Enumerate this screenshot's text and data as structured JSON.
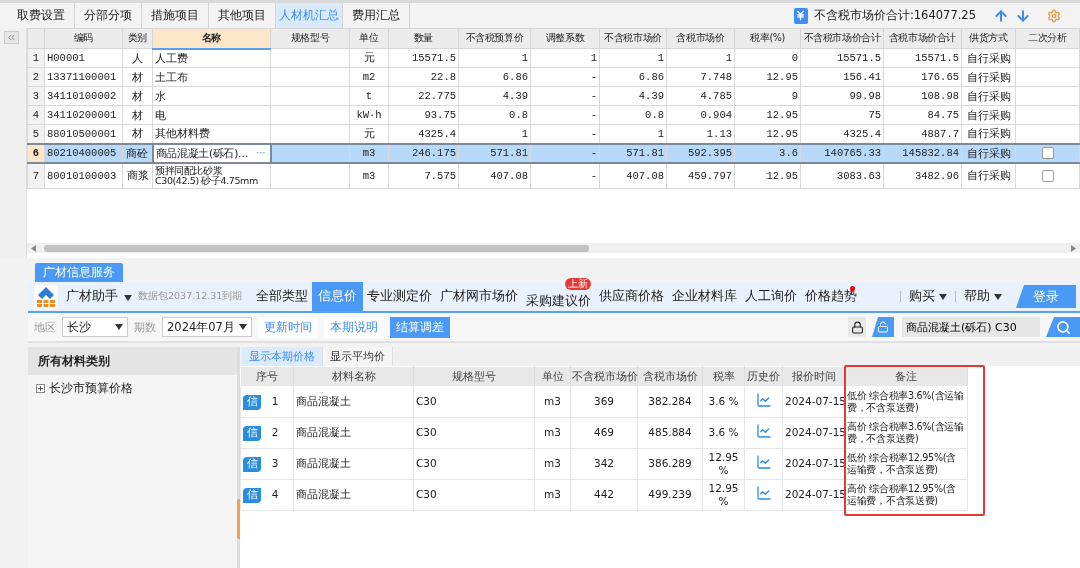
{
  "tabs": [
    {
      "label": "取费设置",
      "selected": false
    },
    {
      "label": "分部分项",
      "selected": false
    },
    {
      "label": "措施项目",
      "selected": false
    },
    {
      "label": "其他项目",
      "selected": false
    },
    {
      "label": "人材机汇总",
      "selected": true
    },
    {
      "label": "费用汇总",
      "selected": false
    }
  ],
  "summary": "不含税市场价合计:164077.25",
  "materials_table": {
    "columns": [
      {
        "label": "编码",
        "highlighted": false
      },
      {
        "label": "类别",
        "highlighted": false
      },
      {
        "label": "名称",
        "highlighted": true
      },
      {
        "label": "规格型号",
        "highlighted": false
      },
      {
        "label": "单位",
        "highlighted": false
      },
      {
        "label": "数量",
        "highlighted": false
      },
      {
        "label": "不含税预算价",
        "highlighted": false
      },
      {
        "label": "调整系数",
        "highlighted": false
      },
      {
        "label": "不含税市场价",
        "highlighted": false
      },
      {
        "label": "含税市场价",
        "highlighted": false
      },
      {
        "label": "税率(%)",
        "highlighted": false
      },
      {
        "label": "不含税市场价合计",
        "highlighted": false
      },
      {
        "label": "含税市场价合计",
        "highlighted": false
      },
      {
        "label": "供货方式",
        "highlighted": false
      },
      {
        "label": "二次分析",
        "highlighted": false
      }
    ],
    "rows": [
      {
        "row_number": "1",
        "selected": false,
        "code": "H00001",
        "type": "人",
        "name": "人工费",
        "unit": "元",
        "qty": "15571.5",
        "budget_price": "1",
        "adjust": "1",
        "market_price": "1",
        "market_price_tax": "1",
        "tax_rate": "0",
        "total": "15571.5",
        "total_tax": "15571.5",
        "supply": "自行采购"
      },
      {
        "row_number": "2",
        "selected": false,
        "code": "13371100001",
        "type": "材",
        "name": "土工布",
        "unit": "m2",
        "qty": "22.8",
        "budget_price": "6.86",
        "adjust": "-",
        "market_price": "6.86",
        "market_price_tax": "7.748",
        "tax_rate": "12.95",
        "total": "156.41",
        "total_tax": "176.65",
        "supply": "自行采购"
      },
      {
        "row_number": "3",
        "selected": false,
        "code": "34110100002",
        "type": "材",
        "name": "水",
        "unit": "t",
        "qty": "22.775",
        "budget_price": "4.39",
        "adjust": "-",
        "market_price": "4.39",
        "market_price_tax": "4.785",
        "tax_rate": "9",
        "total": "99.98",
        "total_tax": "108.98",
        "supply": "自行采购"
      },
      {
        "row_number": "4",
        "selected": false,
        "code": "34110200001",
        "type": "材",
        "name": "电",
        "unit": "kW·h",
        "qty": "93.75",
        "budget_price": "0.8",
        "adjust": "-",
        "market_price": "0.8",
        "market_price_tax": "0.904",
        "tax_rate": "12.95",
        "total": "75",
        "total_tax": "84.75",
        "supply": "自行采购"
      },
      {
        "row_number": "5",
        "selected": false,
        "code": "88010500001",
        "type": "材",
        "name": "其他材料费",
        "unit": "元",
        "qty": "4325.4",
        "budget_price": "1",
        "adjust": "-",
        "market_price": "1",
        "market_price_tax": "1.13",
        "tax_rate": "12.95",
        "total": "4325.4",
        "total_tax": "4887.7",
        "supply": "自行采购"
      },
      {
        "row_number": "6",
        "selected": true,
        "code": "80210400005",
        "type": "商砼",
        "name": "商品混凝土(砾石)…",
        "edit_button": "···",
        "unit": "m3",
        "qty": "246.175",
        "budget_price": "571.81",
        "adjust": "-",
        "market_price": "571.81",
        "market_price_tax": "592.395",
        "tax_rate": "3.6",
        "total": "140765.33",
        "total_tax": "145832.84",
        "supply": "自行采购",
        "analysis_checked": false
      },
      {
        "row_number": "7",
        "selected": false,
        "code": "80010100003",
        "type": "商浆",
        "name": "预拌同配比砂浆\nC30(42.5) 砂子4.75mm",
        "unit": "m3",
        "qty": "7.575",
        "budget_price": "407.08",
        "adjust": "-",
        "market_price": "407.08",
        "market_price_tax": "459.797",
        "tax_rate": "12.95",
        "total": "3083.63",
        "total_tax": "3482.96",
        "supply": "自行采购",
        "analysis_checked": false
      }
    ]
  },
  "info_service": {
    "tab": "广材信息服务",
    "brand": "广材助手",
    "package_note": "数据包2037.12.31到期",
    "nav": [
      {
        "label": "全部类型",
        "selected": false
      },
      {
        "label": "信息价",
        "selected": true
      },
      {
        "label": "专业测定价",
        "selected": false
      },
      {
        "label": "广材网市场价",
        "selected": false
      },
      {
        "label": "采购建议价",
        "selected": false,
        "badge": "上新"
      },
      {
        "label": "供应商价格",
        "selected": false
      },
      {
        "label": "企业材料库",
        "selected": false
      },
      {
        "label": "人工询价",
        "selected": false
      },
      {
        "label": "价格趋势",
        "selected": false,
        "dot": true
      }
    ],
    "menus": [
      "购买",
      "帮助"
    ],
    "login": "登录"
  },
  "filters": {
    "region_label": "地区",
    "region": "长沙",
    "period_label": "期数",
    "period": "2024年07月",
    "buttons": [
      {
        "label": "更新时间",
        "primary": false
      },
      {
        "label": "本期说明",
        "primary": false
      },
      {
        "label": "结算调差",
        "primary": true
      }
    ],
    "search_value": "商品混凝土(砾石) C30"
  },
  "category_panel": {
    "title": "所有材料类别",
    "items": [
      {
        "label": "长沙市预算价格",
        "expanded": false
      }
    ]
  },
  "price_tabs": [
    {
      "label": "显示本期价格",
      "selected": true
    },
    {
      "label": "显示平均价",
      "selected": false
    }
  ],
  "price_table": {
    "columns": [
      "序号",
      "材料名称",
      "规格型号",
      "单位",
      "不含税市场价",
      "含税市场价",
      "税率",
      "历史价",
      "报价时间",
      "备注"
    ],
    "rows": [
      {
        "badge": "信",
        "index": "1",
        "name": "商品混凝土",
        "spec": "C30",
        "unit": "m3",
        "price": "369",
        "price_tax": "382.284",
        "tax_rate": "3.6 %",
        "date": "2024-07-15",
        "remark": "低价 综合税率3.6%(含运输费，不含泵送费)"
      },
      {
        "badge": "信",
        "index": "2",
        "name": "商品混凝土",
        "spec": "C30",
        "unit": "m3",
        "price": "469",
        "price_tax": "485.884",
        "tax_rate": "3.6 %",
        "date": "2024-07-15",
        "remark": "高价 综合税率3.6%(含运输费，不含泵送费)"
      },
      {
        "badge": "信",
        "index": "3",
        "name": "商品混凝土",
        "spec": "C30",
        "unit": "m3",
        "price": "342",
        "price_tax": "386.289",
        "tax_rate": "12.95 %",
        "date": "2024-07-15",
        "remark": "低价 综合税率12.95%(含运输费，不含泵送费)"
      },
      {
        "badge": "信",
        "index": "4",
        "name": "商品混凝土",
        "spec": "C30",
        "unit": "m3",
        "price": "442",
        "price_tax": "499.239",
        "tax_rate": "12.95 %",
        "date": "2024-07-15",
        "remark": "高价 综合税率12.95%(含运输费，不含泵送费)"
      }
    ]
  }
}
